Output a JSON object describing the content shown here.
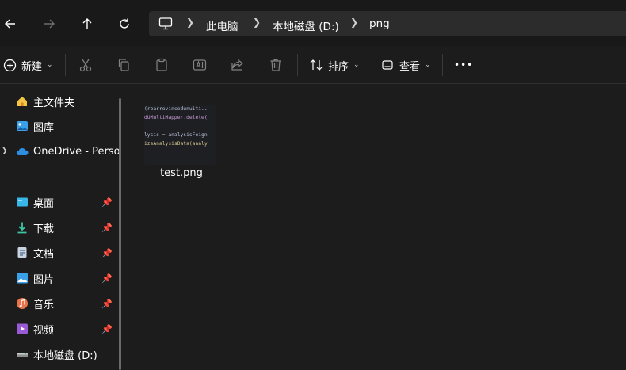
{
  "navigation": {
    "back": "back-arrow",
    "forward": "forward-arrow",
    "up": "up-arrow",
    "refresh": "refresh"
  },
  "addressbar": {
    "crumbs": [
      "此电脑",
      "本地磁盘 (D:)",
      "png"
    ]
  },
  "toolbar": {
    "new_label": "新建",
    "sort_label": "排序",
    "view_label": "查看",
    "more": "•••"
  },
  "sidebar": {
    "items": [
      {
        "label": "主文件夹",
        "icon": "home-icon"
      },
      {
        "label": "图库",
        "icon": "gallery-icon"
      },
      {
        "label": "OneDrive - Perso",
        "icon": "onedrive-icon"
      },
      {
        "label": "桌面",
        "icon": "desktop-icon"
      },
      {
        "label": "下载",
        "icon": "download-icon"
      },
      {
        "label": "文档",
        "icon": "documents-icon"
      },
      {
        "label": "图片",
        "icon": "pictures-icon"
      },
      {
        "label": "音乐",
        "icon": "music-icon"
      },
      {
        "label": "视频",
        "icon": "videos-icon"
      },
      {
        "label": "本地磁盘 (D:)",
        "icon": "drive-icon"
      }
    ]
  },
  "files": [
    {
      "name": "test.png",
      "preview_lines": [
        "(rearrovincedunuiti..",
        "dUMultiMapper.delete(",
        "",
        "lysis = analysisFeign",
        "izeAnalysisData(analy"
      ]
    }
  ],
  "colors": {
    "background": "#1c1c1c",
    "navbar": "#191919",
    "addressbar": "#2c2c2c",
    "accent_blue": "#4cc2ff",
    "folder_yellow": "#f4c542"
  }
}
